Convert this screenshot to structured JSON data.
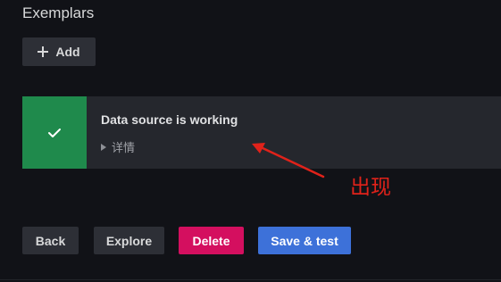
{
  "section": {
    "title": "Exemplars"
  },
  "add_button": {
    "label": "Add",
    "icon": "plus-icon"
  },
  "alert": {
    "status": "success",
    "status_color": "#1f8a4c",
    "icon": "checkmark-icon",
    "title": "Data source is working",
    "details_label": "详情"
  },
  "annotation": {
    "text": "出现",
    "color": "#e0221a"
  },
  "actions": {
    "back_label": "Back",
    "explore_label": "Explore",
    "delete_label": "Delete",
    "save_label": "Save & test",
    "delete_color": "#d40f5f",
    "save_color": "#3d71d9"
  }
}
